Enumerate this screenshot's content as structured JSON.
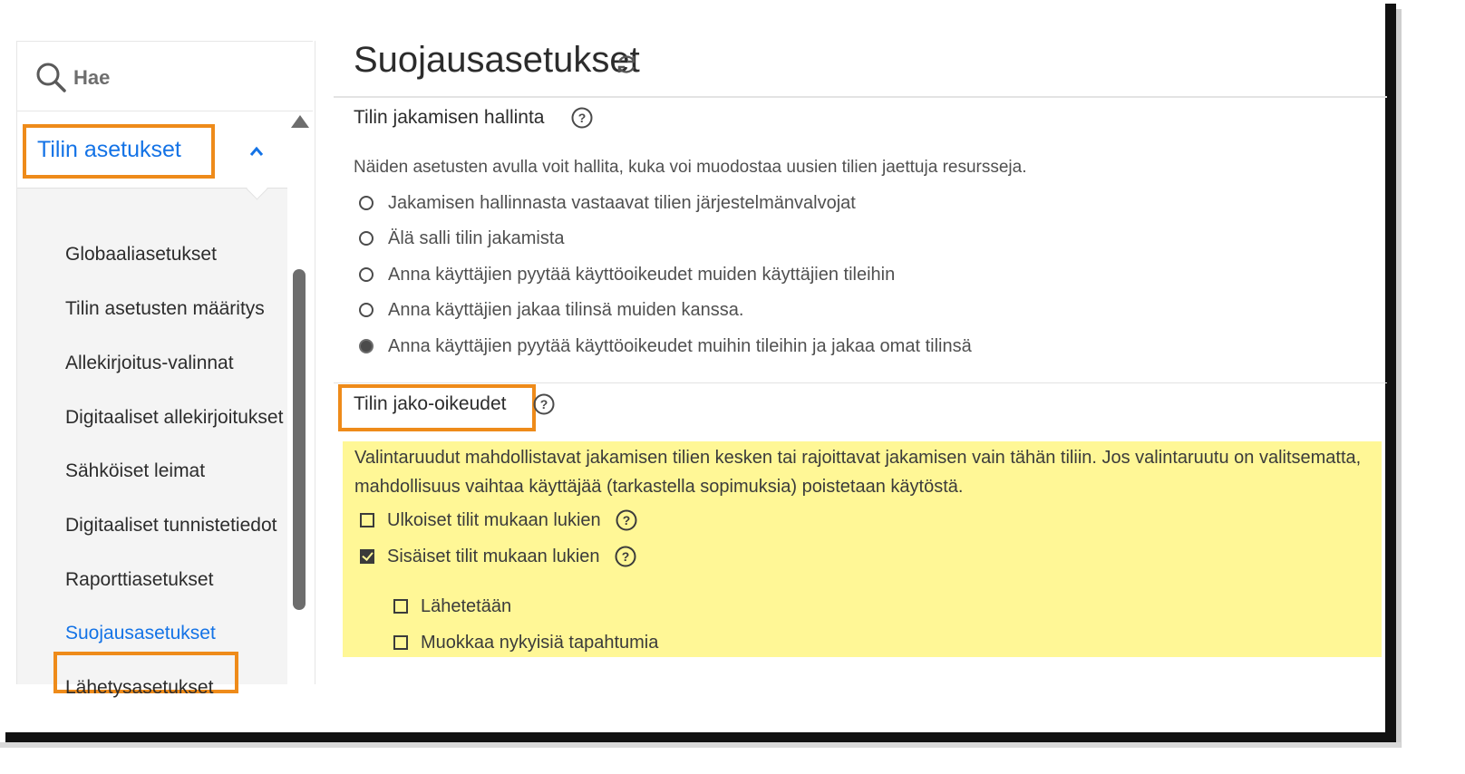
{
  "search": {
    "placeholder": "Hae"
  },
  "sidebar": {
    "section_title": "Tilin asetukset",
    "items": [
      {
        "label": "Globaaliasetukset"
      },
      {
        "label": "Tilin asetusten määritys"
      },
      {
        "label": "Allekirjoitus-valinnat"
      },
      {
        "label": "Digitaaliset allekirjoitukset"
      },
      {
        "label": "Sähköiset leimat"
      },
      {
        "label": "Digitaaliset tunnistetiedot"
      },
      {
        "label": "Raporttiasetukset"
      },
      {
        "label": "Suojausasetukset",
        "active": true
      },
      {
        "label": "Lähetysasetukset"
      }
    ]
  },
  "page": {
    "title": "Suojausasetukset"
  },
  "account_sharing": {
    "heading": "Tilin jakamisen hallinta",
    "description": "Näiden asetusten avulla voit hallita, kuka voi muodostaa uusien tilien jaettuja resursseja.",
    "options": [
      {
        "label": "Jakamisen hallinnasta vastaavat tilien järjestelmänvalvojat",
        "selected": false
      },
      {
        "label": "Älä salli tilin jakamista",
        "selected": false
      },
      {
        "label": "Anna käyttäjien pyytää käyttöoikeudet muiden käyttäjien tileihin",
        "selected": false
      },
      {
        "label": "Anna käyttäjien jakaa tilinsä muiden kanssa.",
        "selected": false
      },
      {
        "label": "Anna käyttäjien pyytää käyttöoikeudet muihin tileihin ja jakaa omat tilinsä",
        "selected": true
      }
    ]
  },
  "sharing_permissions": {
    "heading": "Tilin jako-oikeudet",
    "description": "Valintaruudut mahdollistavat jakamisen tilien kesken tai rajoittavat jakamisen vain tähän tiliin. Jos valintaruutu on valitsematta, mahdollisuus vaihtaa käyttäjää (tarkastella sopimuksia) poistetaan käytöstä.",
    "external": {
      "label": "Ulkoiset tilit mukaan lukien",
      "checked": false
    },
    "internal": {
      "label": "Sisäiset tilit mukaan lukien",
      "checked": true
    },
    "sub_options": [
      {
        "label": "Lähetetään",
        "checked": false
      },
      {
        "label": "Muokkaa nykyisiä tapahtumia",
        "checked": false
      }
    ]
  },
  "colors": {
    "accent": "#1473e6",
    "highlight_border": "#ee8b1a",
    "highlight_fill": "#fff796"
  }
}
